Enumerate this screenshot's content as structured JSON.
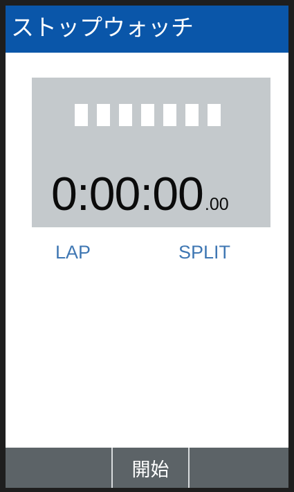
{
  "app": {
    "title": "ストップウォッチ"
  },
  "display": {
    "segments": 7,
    "time_main": "0:00:00",
    "time_fraction": ".00"
  },
  "labels": {
    "lap": "LAP",
    "split": "SPLIT"
  },
  "softkeys": {
    "left": "",
    "center": "開始",
    "right": ""
  },
  "colors": {
    "title_bar": "#0a56a9",
    "panel": "#c4c9cc",
    "label_accent": "#3f77b3",
    "softkey_bar": "#5c6367"
  }
}
